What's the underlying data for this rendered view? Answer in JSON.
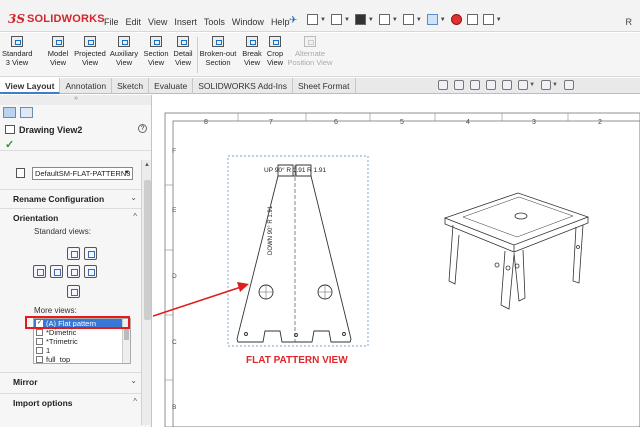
{
  "app": {
    "logo_ds": "3S",
    "logo_text": "SOLIDWORKS",
    "title_right": "R"
  },
  "menu": [
    "File",
    "Edit",
    "View",
    "Insert",
    "Tools",
    "Window",
    "Help"
  ],
  "ribbon": {
    "buttons": [
      {
        "label1": "Standard",
        "label2": "3 View"
      },
      {
        "label1": "Model",
        "label2": "View"
      },
      {
        "label1": "Projected",
        "label2": "View"
      },
      {
        "label1": "Auxiliary",
        "label2": "View"
      },
      {
        "label1": "Section",
        "label2": "View"
      },
      {
        "label1": "Detail",
        "label2": "View"
      },
      {
        "label1": "Broken-out",
        "label2": "Section"
      },
      {
        "label1": "Break",
        "label2": "View"
      },
      {
        "label1": "Crop",
        "label2": "View"
      },
      {
        "label1": "Alternate",
        "label2": "Position View"
      }
    ]
  },
  "tabs": [
    "View Layout",
    "Annotation",
    "Sketch",
    "Evaluate",
    "SOLIDWORKS Add-Ins",
    "Sheet Format"
  ],
  "active_tab": "View Layout",
  "property_manager": {
    "title": "Drawing View2",
    "help": "?",
    "ok": "✓",
    "configuration": "DefaultSM-FLAT-PATTERN3",
    "sections": {
      "rename": "Rename Configuration",
      "orientation": "Orientation",
      "mirror": "Mirror",
      "import": "Import options"
    },
    "standard_views_label": "Standard views:",
    "more_views_label": "More views:",
    "more_views": [
      {
        "label": "(A) Flat pattern",
        "checked": true,
        "selected": true
      },
      {
        "label": "*Dimetric",
        "checked": false,
        "selected": false
      },
      {
        "label": "*Trimetric",
        "checked": false,
        "selected": false
      },
      {
        "label": "1",
        "checked": false,
        "selected": false
      },
      {
        "label": "full_top",
        "checked": false,
        "selected": false
      }
    ]
  },
  "drawing": {
    "column_numbers": [
      "8",
      "7",
      "6",
      "5",
      "4",
      "3",
      "2"
    ],
    "row_letters": [
      "F",
      "E",
      "D",
      "C",
      "B"
    ],
    "bend_up_label": "UP  90° R 1.91",
    "bend_r_label": "R 1.91",
    "bend_down_label": "DOWN  90°  R 1.91",
    "annotation": "FLAT PATTERN VIEW"
  },
  "colors": {
    "accent": "#3877d6",
    "annotation_red": "#e0262b",
    "logo_red": "#d2262b"
  }
}
